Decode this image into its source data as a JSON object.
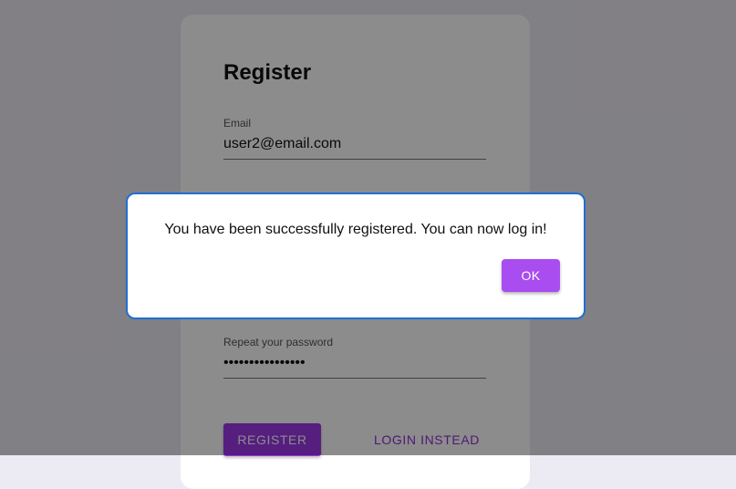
{
  "form": {
    "title": "Register",
    "email": {
      "label": "Email",
      "value": "user2@email.com"
    },
    "repeat_password": {
      "label": "Repeat your password",
      "value": "••••••••••••••••"
    },
    "register_label": "REGISTER",
    "login_label": "LOGIN INSTEAD"
  },
  "dialog": {
    "message": "You have been successfully registered. You can now log in!",
    "ok_label": "OK"
  },
  "colors": {
    "primary": "#9c37e8",
    "dialog_border": "#1f6fd1",
    "page_background": "#eceaf3"
  }
}
